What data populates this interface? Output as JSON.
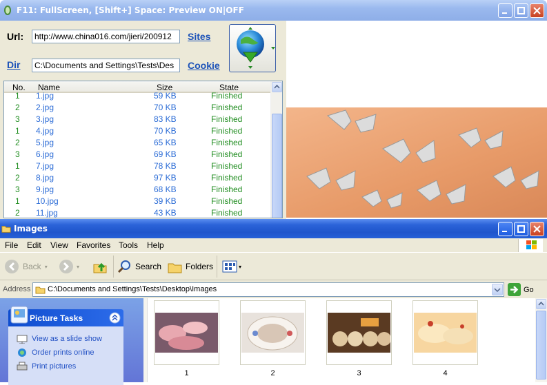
{
  "downloader": {
    "title": "F11: FullScreen, [Shift+] Space: Preview ON|OFF",
    "url_label": "Url:",
    "url_value": "http://www.china016.com/jieri/200912",
    "sites_link": "Sites",
    "dir_link": "Dir",
    "dir_value": "C:\\Documents and Settings\\Tests\\Des",
    "cookie_link": "Cookie",
    "columns": [
      "No.",
      "Name",
      "Size",
      "State"
    ],
    "rows": [
      {
        "no": "1",
        "name": "1.jpg",
        "size": "59 KB",
        "state": "Finished"
      },
      {
        "no": "2",
        "name": "2.jpg",
        "size": "70 KB",
        "state": "Finished"
      },
      {
        "no": "3",
        "name": "3.jpg",
        "size": "83 KB",
        "state": "Finished"
      },
      {
        "no": "1",
        "name": "4.jpg",
        "size": "70 KB",
        "state": "Finished"
      },
      {
        "no": "2",
        "name": "5.jpg",
        "size": "65 KB",
        "state": "Finished"
      },
      {
        "no": "3",
        "name": "6.jpg",
        "size": "69 KB",
        "state": "Finished"
      },
      {
        "no": "1",
        "name": "7.jpg",
        "size": "78 KB",
        "state": "Finished"
      },
      {
        "no": "2",
        "name": "8.jpg",
        "size": "97 KB",
        "state": "Finished"
      },
      {
        "no": "3",
        "name": "9.jpg",
        "size": "68 KB",
        "state": "Finished"
      },
      {
        "no": "1",
        "name": "10.jpg",
        "size": "39 KB",
        "state": "Finished"
      },
      {
        "no": "2",
        "name": "11.jpg",
        "size": "43 KB",
        "state": "Finished"
      }
    ]
  },
  "explorer": {
    "title": "Images",
    "menu": [
      "File",
      "Edit",
      "View",
      "Favorites",
      "Tools",
      "Help"
    ],
    "back_label": "Back",
    "search_label": "Search",
    "folders_label": "Folders",
    "address_label": "Address",
    "address_value": "C:\\Documents and Settings\\Tests\\Desktop\\Images",
    "go_label": "Go",
    "tasks_title": "Picture Tasks",
    "tasks": [
      "View as a slide show",
      "Order prints online",
      "Print pictures"
    ],
    "files": [
      "1",
      "2",
      "3",
      "4"
    ]
  },
  "colors": {
    "xp_blue": "#2b63d8",
    "finished_green": "#1e8c1e",
    "link_blue": "#1c52b8"
  }
}
